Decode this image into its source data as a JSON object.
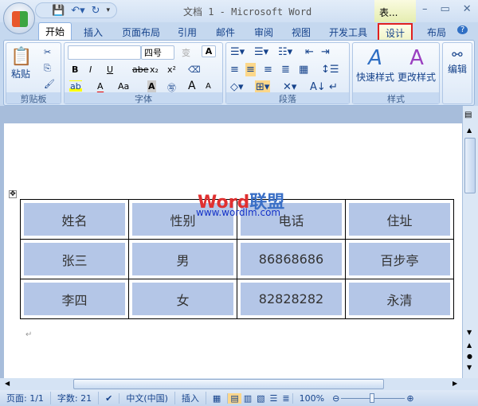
{
  "title": "文档 1 - Microsoft Word",
  "context_tab_label": "表...",
  "tabs": [
    "开始",
    "插入",
    "页面布局",
    "引用",
    "邮件",
    "审阅",
    "视图",
    "开发工具",
    "设计",
    "布局"
  ],
  "ribbon": {
    "clipboard": {
      "label": "剪贴板",
      "paste": "粘贴"
    },
    "font": {
      "label": "字体",
      "font_name": "",
      "font_size": "四号",
      "bold": "B",
      "italic": "I",
      "underline": "U",
      "strike": "abe",
      "sub": "x₂",
      "sup": "x²",
      "change_case": "Aa",
      "grow": "A",
      "shrink": "A",
      "color_a": "A"
    },
    "paragraph": {
      "label": "段落"
    },
    "styles": {
      "label": "样式",
      "quick": "快速样式",
      "change": "更改样式"
    },
    "editing": {
      "label": "编辑"
    }
  },
  "watermark": {
    "brand_a": "Word",
    "brand_b": "联盟",
    "url": "www.wordlm.com"
  },
  "table": {
    "rows": [
      [
        "姓名",
        "性别",
        "电话",
        "住址"
      ],
      [
        "张三",
        "男",
        "86868686",
        "百步亭"
      ],
      [
        "李四",
        "女",
        "82828282",
        "永清"
      ]
    ]
  },
  "status": {
    "page": "页面: 1/1",
    "words": "字数: 21",
    "language": "中文(中国)",
    "mode": "插入",
    "zoom": "100%"
  }
}
